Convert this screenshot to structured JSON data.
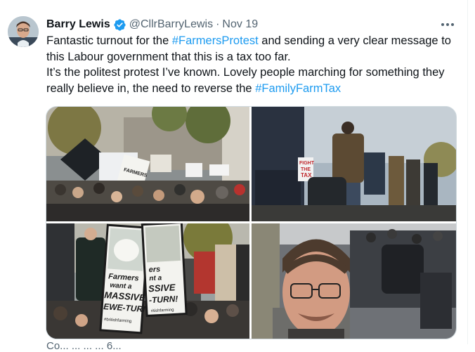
{
  "author": {
    "name": "Barry Lewis",
    "handle": "@CllrBarryLewis",
    "separator": "·",
    "date": "Nov 19",
    "verified": true
  },
  "icons": {
    "verified": "verified-badge-icon",
    "more": "more-options-icon"
  },
  "colors": {
    "link": "#1d9bf0",
    "secondary_text": "#536471",
    "verified_badge": "#1d9bf0"
  },
  "tweet": {
    "line1_pre": "Fantastic turnout for the ",
    "line1_tag": "#FarmersProtest",
    "line1_post": " and sending a very clear message to this Labour government that this is a tax too far.",
    "line2_pre": "It’s the politest protest I’ve known. Lovely people marching for something they really believe in, the need to reverse the ",
    "line2_tag": "#FamilyFarmTax"
  },
  "photos": {
    "top_left": {
      "sign_text": "FARMERS"
    },
    "top_right": {
      "sign_line1": "FIGHT",
      "sign_line2": "THE",
      "sign_line3": "TAX"
    },
    "bottom_left": {
      "sign_left_line1": "Farmers",
      "sign_left_line2": "want a",
      "sign_left_line3": "MASSIVE",
      "sign_left_line4": "EWE-TURN!",
      "sign_left_footer": "#britishfarming",
      "sign_right_line1": "ers",
      "sign_right_line2": "nt a",
      "sign_right_line3": "SSIVE",
      "sign_right_line4": "-TURN!",
      "sign_right_footer": "ritishfarming"
    }
  },
  "below_media_text": "Co... ... ... ... 6..."
}
